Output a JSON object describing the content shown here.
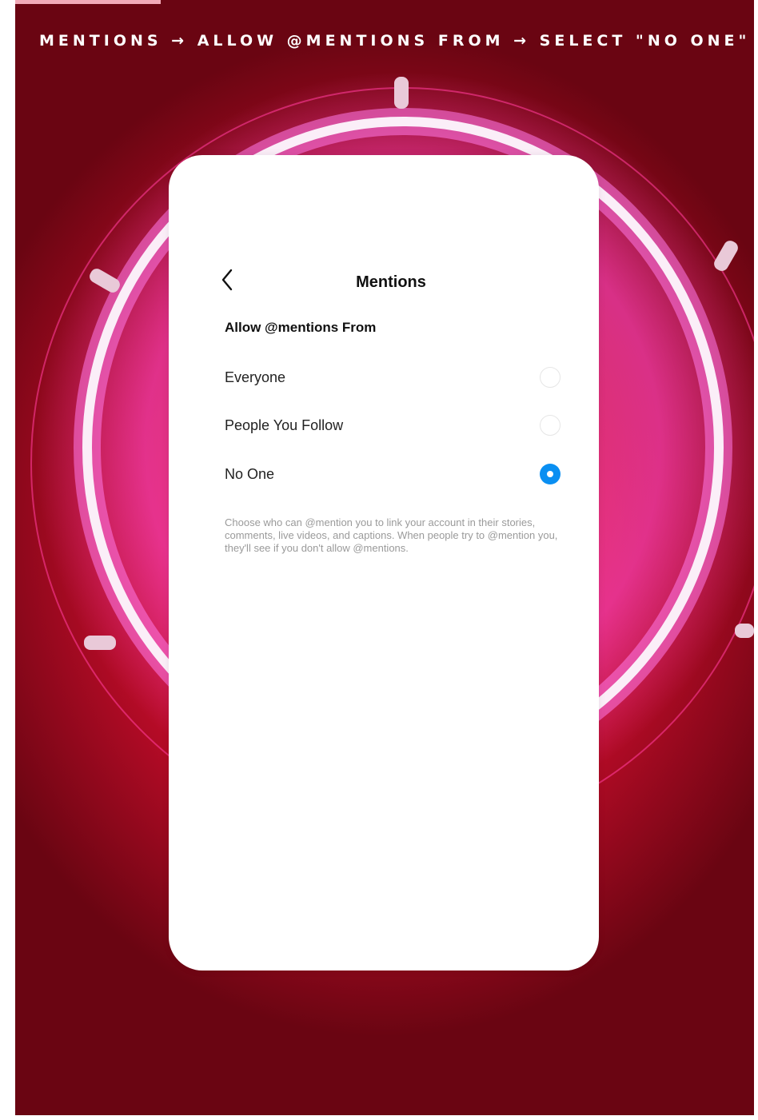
{
  "caption": "MENTIONS → ALLOW @MENTIONS FROM → SELECT \"NO ONE\"",
  "screen": {
    "back_icon": "chevron-left-icon",
    "title": "Mentions",
    "section_title": "Allow @mentions From",
    "options": [
      {
        "label": "Everyone",
        "selected": false
      },
      {
        "label": "People You Follow",
        "selected": false
      },
      {
        "label": "No One",
        "selected": true
      }
    ],
    "help_text": "Choose who can @mention you to link your account in their stories, comments, live videos, and captions. When people try to @mention you, they'll see if you don't allow @mentions."
  },
  "colors": {
    "accent": "#0a8ff2",
    "background_red": "#e3143f",
    "neon_pink": "#ff4fd8"
  }
}
